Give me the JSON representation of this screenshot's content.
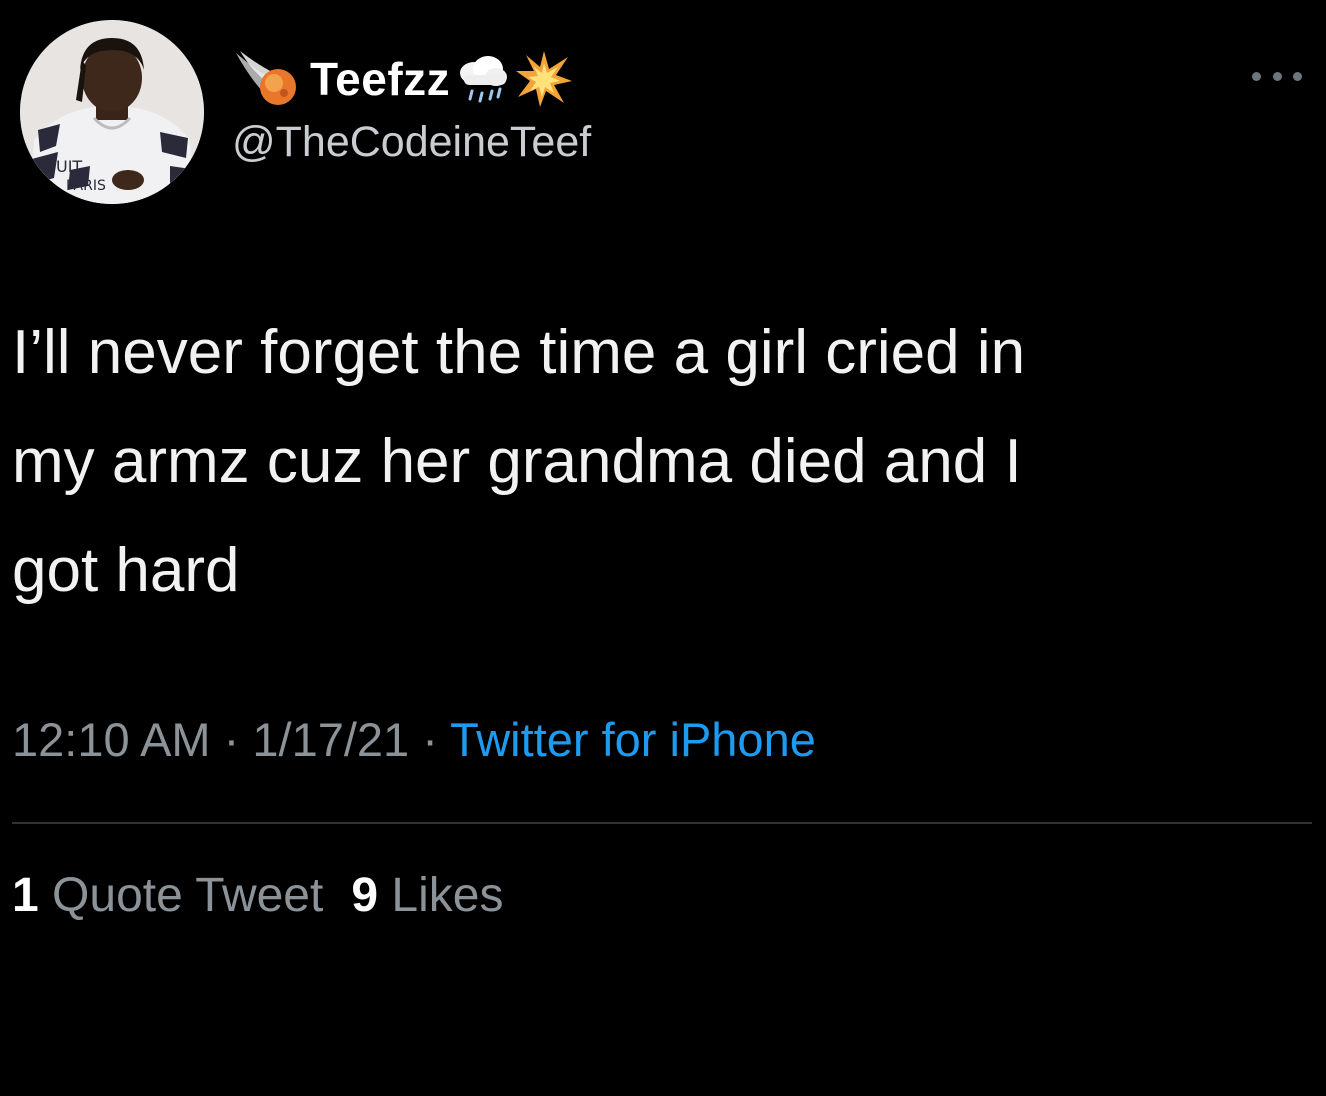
{
  "author": {
    "display_name": "Teefzz",
    "handle": "@TheCodeineTeef",
    "name_emojis": [
      "comet-emoji",
      "cloud-rain-emoji",
      "collision-emoji"
    ],
    "avatar_text": [
      "UIT",
      "PARIS"
    ]
  },
  "tweet": {
    "text": "I’ll never forget the time a girl cried in\nmy armz cuz her grandma died and I\ngot hard",
    "time": "12:10 AM",
    "date": "1/17/21",
    "separator": "·",
    "source": "Twitter for iPhone"
  },
  "stats": {
    "quote_count": "1",
    "quote_label": "Quote Tweet",
    "like_count": "9",
    "like_label": "Likes"
  },
  "colors": {
    "background": "#000000",
    "link": "#1d9bf0",
    "muted": "#8b9298"
  }
}
